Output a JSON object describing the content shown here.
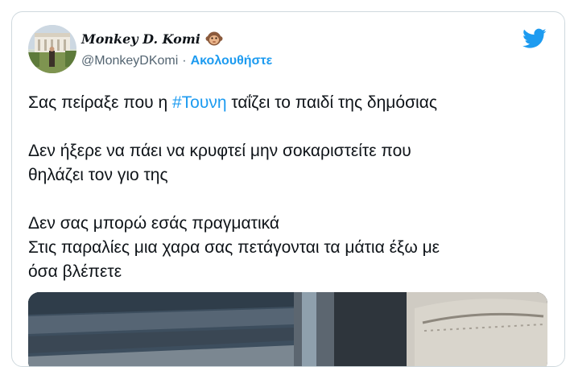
{
  "tweet": {
    "author_name": "Monkey D. Komi",
    "author_emoji": "monkey-face-icon",
    "handle": "@MonkeyDKomi",
    "separator": "·",
    "follow_label": "Ακολουθήστε",
    "logo": "twitter-bird-icon",
    "text": {
      "p1_before": "Σας πείραξε που η ",
      "p1_hashtag": "#Τουνη",
      "p1_after": " ταΐζει το παιδί της δημόσιας",
      "p2_line1": "Δεν ήξερε να πάει να κρυφτεί μην σοκαριστείτε που",
      "p2_line2": "θηλάζει τον γιο της",
      "p3_line1": "Δεν σας μπορώ εσάς πραγματικά",
      "p3_line2": "Στις παραλίες μια χαρα σας πετάγονται τα μάτια έξω με",
      "p3_line3": "όσα βλέπετε"
    }
  },
  "colors": {
    "accent": "#1d9bf0",
    "text": "#0f1419",
    "muted": "#536471",
    "border": "#cfd9de"
  }
}
